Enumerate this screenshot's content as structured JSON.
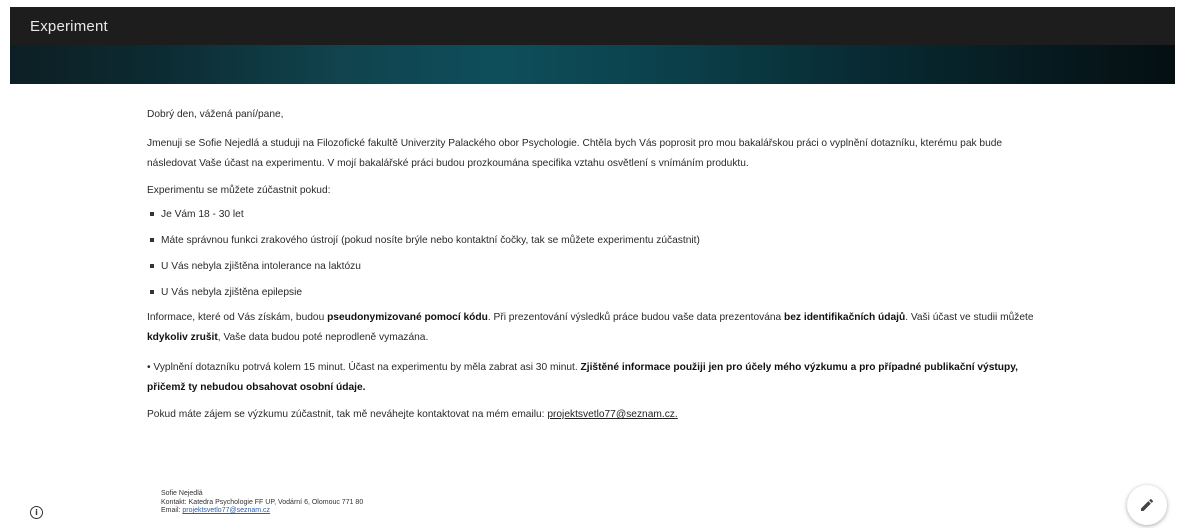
{
  "app": {
    "title": "Experiment"
  },
  "survey": {
    "greeting": "Dobrý den, vážená paní/pane,",
    "intro": "Jmenuji se Sofie Nejedlá a studuji na Filozofické fakultě Univerzity Palackého obor Psychologie. Chtěla bych Vás poprosit pro mou bakalářskou práci o vyplnění dotazníku, kterému pak bude následovat Vaše účast na experimentu. V mojí bakalářské práci budou prozkoumána specifika vztahu osvětlení s vnímáním produktu.",
    "conditions_label": "Experimentu se můžete zúčastnit pokud:",
    "conditions": [
      "Je Vám 18 - 30 let",
      "Máte správnou funkci zrakového ústrojí (pokud nosíte brýle nebo kontaktní  čočky, tak se můžete experimentu zúčastnit)",
      "U Vás nebyla zjištěna intolerance na laktózu",
      "U Vás nebyla zjištěna epilepsie"
    ],
    "info": {
      "part1": "Informace, které od Vás získám, budou ",
      "bold1": "pseudonymizované pomocí kódu",
      "part2": ". Při prezentování výsledků práce budou vaše data prezentována ",
      "bold2": "bez identifikačních údajů",
      "part3": ". Vaši účast ve studii můžete ",
      "bold3": "kdykoliv zrušit",
      "part4": ", Vaše data budou poté neprodleně vymazána."
    },
    "time": {
      "part1": "• Vyplnění dotazníku potrvá kolem 15 minut. Účast na experimentu by měla zabrat asi 30 minut. ",
      "bold1": "Zjištěné informace použiji jen pro účely mého výzkumu a pro případné publikační výstupy, přičemž ty nebudou obsahovat osobní údaje."
    },
    "contact": {
      "text": "Pokud máte zájem se výzkumu zúčastnit, tak mě neváhejte kontaktovat na mém emailu: ",
      "email": "projektsvetlo77@seznam.cz."
    }
  },
  "footer": {
    "name": "Sofie Nejedlá",
    "address": "Kontakt: Katedra Psychologie FF UP, Vodární 6, Olomouc 771 80",
    "email_label": "Email: ",
    "email": "projektsvetlo77@seznam.cz"
  },
  "icons": {
    "info": "info-icon",
    "edit": "pencil-icon"
  }
}
